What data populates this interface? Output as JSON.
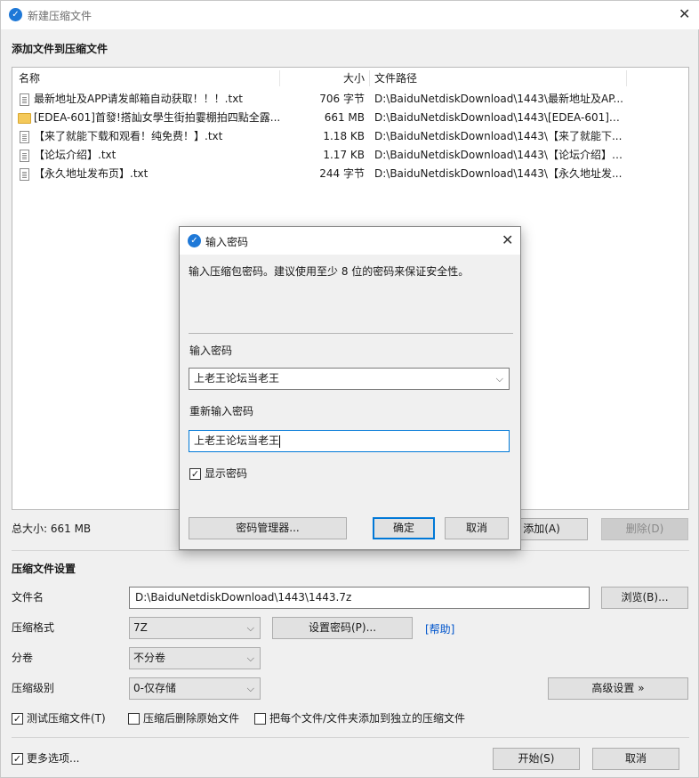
{
  "window": {
    "title": "新建压缩文件",
    "app_icon": "baidunetdisk-icon"
  },
  "add_section": {
    "title": "添加文件到压缩文件"
  },
  "file_list": {
    "columns": [
      "名称",
      "大小",
      "文件路径"
    ],
    "rows": [
      {
        "icon": "text-file-icon",
        "name": "最新地址及APP请发邮箱自动获取！！！.txt",
        "size": "706 字节",
        "path": "D:\\BaiduNetdiskDownload\\1443\\最新地址及AP..."
      },
      {
        "icon": "folder-icon",
        "name": "[EDEA-601]首發!搭訕女學生街拍霎棚拍四點全露...",
        "size": "661 MB",
        "path": "D:\\BaiduNetdiskDownload\\1443\\[EDEA-601]首..."
      },
      {
        "icon": "text-file-icon",
        "name": "【来了就能下载和观看！纯免费！】.txt",
        "size": "1.18 KB",
        "path": "D:\\BaiduNetdiskDownload\\1443\\【来了就能下..."
      },
      {
        "icon": "text-file-icon",
        "name": "【论坛介绍】.txt",
        "size": "1.17 KB",
        "path": "D:\\BaiduNetdiskDownload\\1443\\【论坛介绍】...."
      },
      {
        "icon": "text-file-icon",
        "name": "【永久地址发布页】.txt",
        "size": "244 字节",
        "path": "D:\\BaiduNetdiskDownload\\1443\\【永久地址发..."
      }
    ]
  },
  "total_size": "总大小: 661 MB",
  "list_buttons": {
    "add": "添加(A)",
    "remove": "删除(D)"
  },
  "settings": {
    "title": "压缩文件设置",
    "filename_label": "文件名",
    "filename_value": "D:\\BaiduNetdiskDownload\\1443\\1443.7z",
    "browse": "浏览(B)...",
    "format_label": "压缩格式",
    "format_value": "7Z",
    "set_password": "设置密码(P)...",
    "help_link": "[帮助]",
    "split_label": "分卷",
    "split_value": "不分卷",
    "level_label": "压缩级别",
    "level_value": "0-仅存储",
    "advanced": "高级设置 »",
    "opt_test": "测试压缩文件(T)",
    "opt_test_checked": true,
    "opt_delete": "压缩后删除原始文件",
    "opt_delete_checked": false,
    "opt_separate": "把每个文件/文件夹添加到独立的压缩文件",
    "opt_separate_checked": false
  },
  "footer": {
    "more_options": "更多选项...",
    "more_options_checked": true,
    "start": "开始(S)",
    "cancel": "取消"
  },
  "dialog": {
    "title": "输入密码",
    "description": "输入压缩包密码。建议使用至少 8 位的密码来保证安全性。",
    "password_label": "输入密码",
    "password_value": "上老王论坛当老王",
    "confirm_label": "重新输入密码",
    "confirm_value": "上老王论坛当老王",
    "show_password": "显示密码",
    "show_password_checked": true,
    "manager_button": "密码管理器...",
    "ok_button": "确定",
    "cancel_button": "取消"
  }
}
